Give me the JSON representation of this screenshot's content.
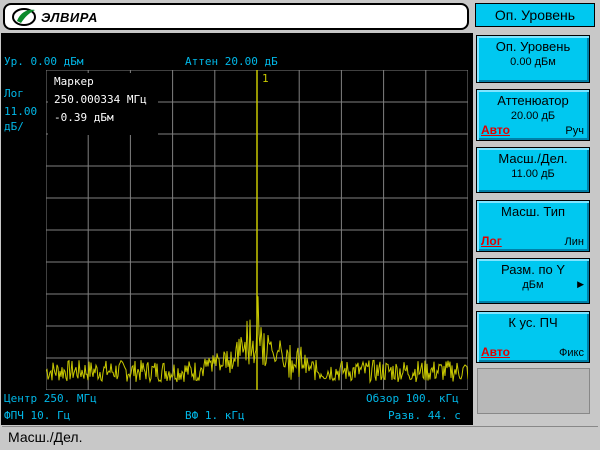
{
  "header": {
    "brand": "ЭЛВИРА",
    "top_softkey": "Оп. Уровень"
  },
  "screen": {
    "ref_level": "Ур. 0.00 дБм",
    "atten": "Аттен 20.00 дБ",
    "marker_number": "1",
    "scale_type": "Лог",
    "scale_value": "11.00",
    "scale_unit": "дБ/",
    "marker": {
      "title": "Маркер",
      "frequency": "250.000334 МГц",
      "level": "-0.39 дБм"
    },
    "center": "Центр 250. МГц",
    "span": "Обзор 100. кГц",
    "rbw": "ФПЧ 10. Гц",
    "vbw": "ВФ 1. кГц",
    "sweep": "Разв. 44. с"
  },
  "softkeys": [
    {
      "title": "Оп. Уровень",
      "value": "0.00 дБм"
    },
    {
      "title": "Аттенюатор",
      "value": "20.00 дБ",
      "opt_left": "Авто",
      "opt_right": "Руч"
    },
    {
      "title": "Масш./Дел.",
      "value": "11.00 дБ"
    },
    {
      "title": "Масш. Тип",
      "opt_left": "Лог",
      "opt_right": "Лин"
    },
    {
      "title": "Разм. по Y",
      "value": "дБм"
    },
    {
      "title": "К ус. ПЧ",
      "opt_left": "Авто",
      "opt_right": "Фикс"
    }
  ],
  "status": "Масш./Дел.",
  "colors": {
    "trace": "#c8c800",
    "grid": "#808080",
    "softkey": "#00c8f0",
    "label": "#00b8e8",
    "active_option": "#e00000"
  },
  "icons": {
    "logo": "brand-logo-icon",
    "submenu": "triangle-right-icon"
  }
}
